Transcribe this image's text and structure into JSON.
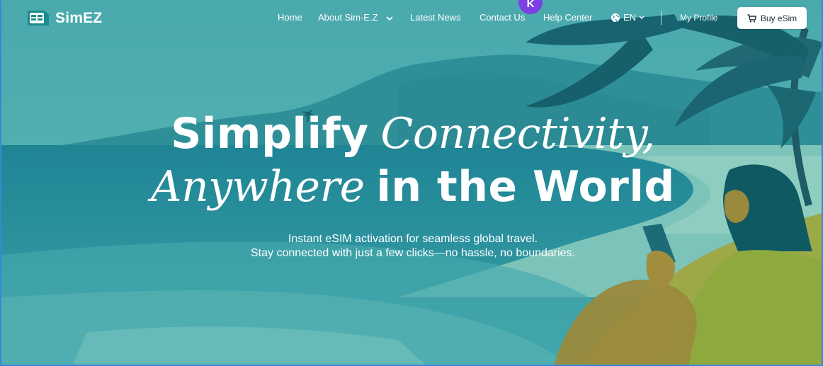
{
  "brand": {
    "name": "SimEZ"
  },
  "nav": {
    "links": [
      "Home",
      "About Sim-E.Z",
      "Latest News",
      "Contact Us",
      "Help Center"
    ],
    "language": "EN",
    "profile": "My Profile",
    "buy_button": "Buy eSim",
    "avatar_initial": "K"
  },
  "hero": {
    "line1_bold": "Simplify",
    "line1_italic": "Connectivity,",
    "line2_italic": "Anywhere",
    "line2_bold": "in the World",
    "subtitle_line1": "Instant eSIM activation for seamless global travel.",
    "subtitle_line2": "Stay connected with just a few clicks—no hassle, no boundaries."
  },
  "colors": {
    "sea": "#2b93a0",
    "sky": "#58b5b6",
    "beach": "#7fc3bb",
    "accent_avatar": "#7b3fe4",
    "sand_green": "#8aa844"
  },
  "icons": [
    "sim-logo-icon",
    "chevron-down-icon",
    "globe-icon",
    "cart-icon"
  ]
}
